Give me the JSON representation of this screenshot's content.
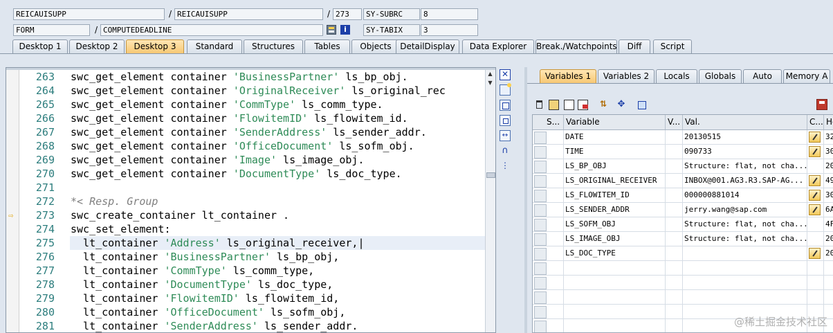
{
  "header": {
    "row1": {
      "program": "REICAUISUPP",
      "include": "REICAUISUPP",
      "line": "273",
      "sysfield_label": "SY-SUBRC",
      "sysfield_value": "8"
    },
    "row2": {
      "event_type": "FORM",
      "event_name": "COMPUTEDEADLINE",
      "sysfield_label": "SY-TABIX",
      "sysfield_value": "3"
    },
    "separator": "/"
  },
  "tabs": [
    {
      "label": "Desktop 1"
    },
    {
      "label": "Desktop 2"
    },
    {
      "label": "Desktop 3",
      "active": true
    },
    {
      "label": "Standard"
    },
    {
      "label": "Structures"
    },
    {
      "label": "Tables"
    },
    {
      "label": "Objects"
    },
    {
      "label": "DetailDisplay"
    },
    {
      "label": "Data Explorer"
    },
    {
      "label": "Break./Watchpoints"
    },
    {
      "label": "Diff"
    },
    {
      "label": "Script"
    }
  ],
  "code": {
    "current_line": "273",
    "lines": [
      {
        "num": "263",
        "pre": "swc_get_element container ",
        "str": "'BusinessPartner'",
        "post": " ls_bp_obj."
      },
      {
        "num": "264",
        "pre": "swc_get_element container ",
        "str": "'OriginalReceiver'",
        "post": " ls_original_rec"
      },
      {
        "num": "265",
        "pre": "swc_get_element container ",
        "str": "'CommType'",
        "post": " ls_comm_type."
      },
      {
        "num": "266",
        "pre": "swc_get_element container ",
        "str": "'FlowitemID'",
        "post": " ls_flowitem_id."
      },
      {
        "num": "267",
        "pre": "swc_get_element container ",
        "str": "'SenderAddress'",
        "post": " ls_sender_addr."
      },
      {
        "num": "268",
        "pre": "swc_get_element container ",
        "str": "'OfficeDocument'",
        "post": " ls_sofm_obj."
      },
      {
        "num": "269",
        "pre": "swc_get_element container ",
        "str": "'Image'",
        "post": " ls_image_obj."
      },
      {
        "num": "270",
        "pre": "swc_get_element container ",
        "str": "'DocumentType'",
        "post": " ls_doc_type."
      },
      {
        "num": "271",
        "pre": "",
        "str": "",
        "post": ""
      },
      {
        "num": "272",
        "comment": "*< Resp. Group"
      },
      {
        "num": "273",
        "pre": "swc_create_container lt_container .",
        "str": "",
        "post": ""
      },
      {
        "num": "274",
        "pre": "swc_set_element:",
        "str": "",
        "post": ""
      },
      {
        "num": "275",
        "pre": "  lt_container ",
        "str": "'Address'",
        "post": " ls_original_receiver,"
      },
      {
        "num": "276",
        "pre": "  lt_container ",
        "str": "'BusinessPartner'",
        "post": " ls_bp_obj,"
      },
      {
        "num": "277",
        "pre": "  lt_container ",
        "str": "'CommType'",
        "post": " ls_comm_type,"
      },
      {
        "num": "278",
        "pre": "  lt_container ",
        "str": "'DocumentType'",
        "post": " ls_doc_type,"
      },
      {
        "num": "279",
        "pre": "  lt_container ",
        "str": "'FlowitemID'",
        "post": " ls_flowitem_id,"
      },
      {
        "num": "280",
        "pre": "  lt_container ",
        "str": "'OfficeDocument'",
        "post": " ls_sofm_obj,"
      },
      {
        "num": "281",
        "pre": "  lt_container ",
        "str": "'SenderAddress'",
        "post": " ls_sender_addr."
      }
    ]
  },
  "right_tabs": [
    {
      "label": "Variables 1",
      "active": true
    },
    {
      "label": "Variables 2"
    },
    {
      "label": "Locals"
    },
    {
      "label": "Globals"
    },
    {
      "label": "Auto"
    },
    {
      "label": "Memory A"
    }
  ],
  "grid": {
    "headers": {
      "s": "S...",
      "variable": "Variable",
      "v": "V...",
      "val": "Val.",
      "c": "C...",
      "h": "He"
    },
    "rows": [
      {
        "variable": "DATE",
        "val": "20130515",
        "edit": true,
        "h": "32"
      },
      {
        "variable": "TIME",
        "val": "090733",
        "edit": true,
        "h": "30"
      },
      {
        "variable": "LS_BP_OBJ",
        "val": "Structure: flat, not cha...",
        "edit": false,
        "h": "20"
      },
      {
        "variable": "LS_ORIGINAL_RECEIVER",
        "val": "INBOX@001.AG3.R3.SAP-AG...",
        "edit": true,
        "h": "49"
      },
      {
        "variable": "LS_FLOWITEM_ID",
        "val": "000000881014",
        "edit": true,
        "h": "30"
      },
      {
        "variable": "LS_SENDER_ADDR",
        "val": "jerry.wang@sap.com",
        "edit": true,
        "h": "6A"
      },
      {
        "variable": "LS_SOFM_OBJ",
        "val": "Structure: flat, not cha...",
        "edit": false,
        "h": "4F"
      },
      {
        "variable": "LS_IMAGE_OBJ",
        "val": "Structure: flat, not cha...",
        "edit": false,
        "h": "20"
      },
      {
        "variable": "LS_DOC_TYPE",
        "val": "",
        "edit": true,
        "h": "20"
      }
    ],
    "empty_rows": 6
  },
  "watermark": "@稀土掘金技术社区"
}
